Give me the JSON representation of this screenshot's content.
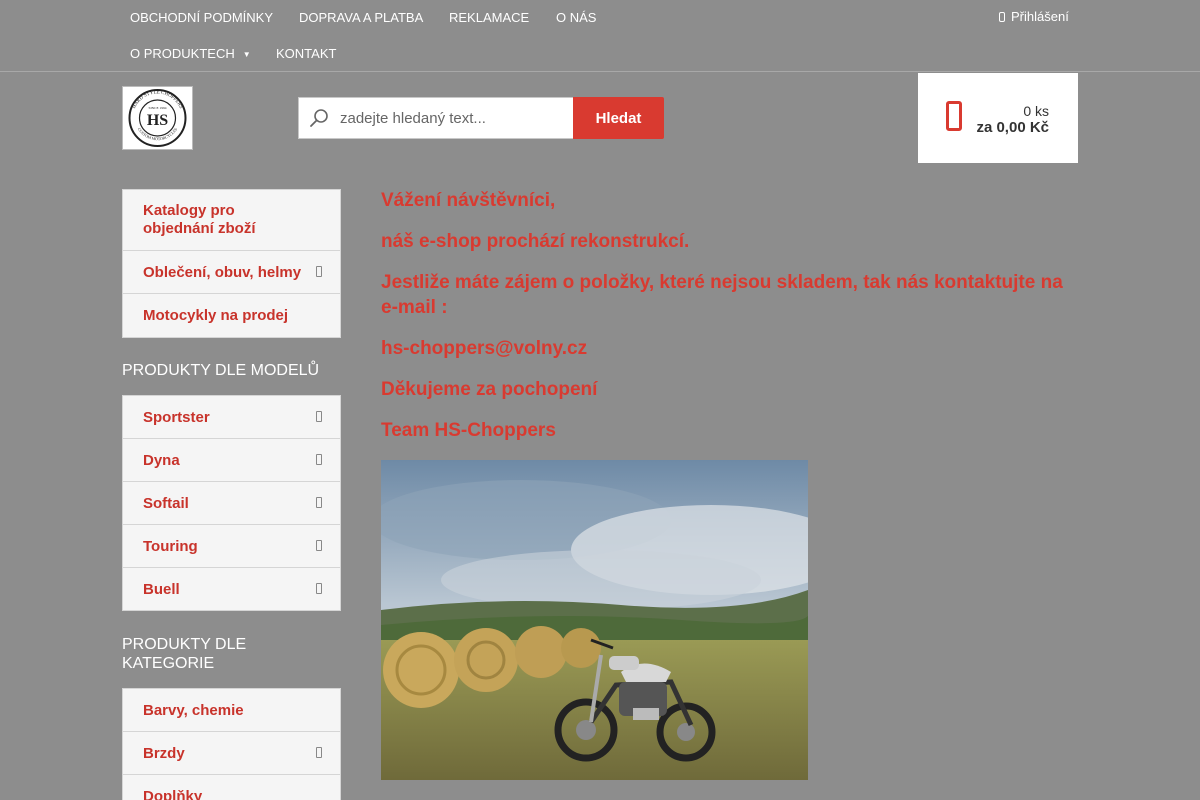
{
  "topnav": {
    "links": [
      "OBCHODNÍ PODMÍNKY",
      "DOPRAVA A PLATBA",
      "REKLAMACE",
      "O NÁS",
      "O PRODUKTECH",
      "KONTAKT"
    ],
    "caret": "▼",
    "login_label": "Přihlášení"
  },
  "header": {
    "logo_top": "HARD STYLE CHOPPERS",
    "logo_mark": "HS",
    "logo_since": "SINCE 1994",
    "logo_bottom": "CUSTOM MOTORCYCLES",
    "search": {
      "placeholder": "zadejte hledaný text...",
      "button_label": "Hledat"
    },
    "cart": {
      "count": "0 ks",
      "total": "za 0,00 Kč"
    }
  },
  "sidebar": {
    "top_menu": [
      "Katalogy pro objednání zboží",
      "Oblečení, obuv, helmy",
      "Motocykly na prodej"
    ],
    "models_heading": "PRODUKTY DLE MODELŮ",
    "models": [
      "Sportster",
      "Dyna",
      "Softail",
      "Touring",
      "Buell"
    ],
    "categories_heading": "PRODUKTY DLE KATEGORIE",
    "categories": [
      "Barvy, chemie",
      "Brzdy",
      "Doplňky"
    ]
  },
  "content": {
    "greeting": "Vážení návštěvníci,",
    "line1": "náš e-shop prochází rekonstrukcí.",
    "line2": "Jestliže máte zájem o položky, které nejsou skladem, tak nás kontaktujte na e-mail :",
    "email": "hs-choppers@volny.cz",
    "thanks": "Děkujeme za pochopení",
    "team": "Team HS-Choppers"
  },
  "colors": {
    "accent": "#d93a30",
    "background": "#8d8d8d"
  }
}
